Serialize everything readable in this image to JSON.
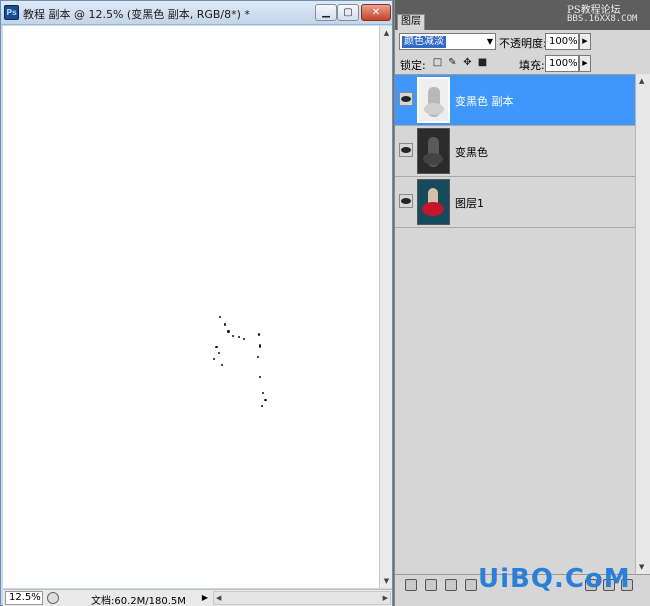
{
  "document": {
    "app_icon": "Ps",
    "title": "教程 副本 @ 12.5% (变黑色 副本, RGB/8*) *",
    "controls": {
      "minimize": "▁",
      "maximize": "▢",
      "close": "✕"
    },
    "status": {
      "zoom": "12.5%",
      "doc_info": "文档:60.2M/180.5M"
    }
  },
  "layers_panel": {
    "tab_label": "图层",
    "watermark_site": "PS教程论坛",
    "watermark_url": "BBS.16XX8.COM",
    "blend_mode": "颜色减淡",
    "opacity_label": "不透明度:",
    "opacity_value": "100%",
    "lock_label": "锁定:",
    "fill_label": "填充:",
    "fill_value": "100%",
    "layers": [
      {
        "name": "变黑色 副本",
        "selected": true,
        "visible": true
      },
      {
        "name": "变黑色",
        "selected": false,
        "visible": true
      },
      {
        "name": "图层1",
        "selected": false,
        "visible": true
      }
    ]
  },
  "watermark_logo": "UiBQ.CoM",
  "colors": {
    "selection": "#3f97fb",
    "panel_bg": "#d6d6d6",
    "titlebar": "#c9d8ea",
    "logo": "#2a7fd8"
  }
}
